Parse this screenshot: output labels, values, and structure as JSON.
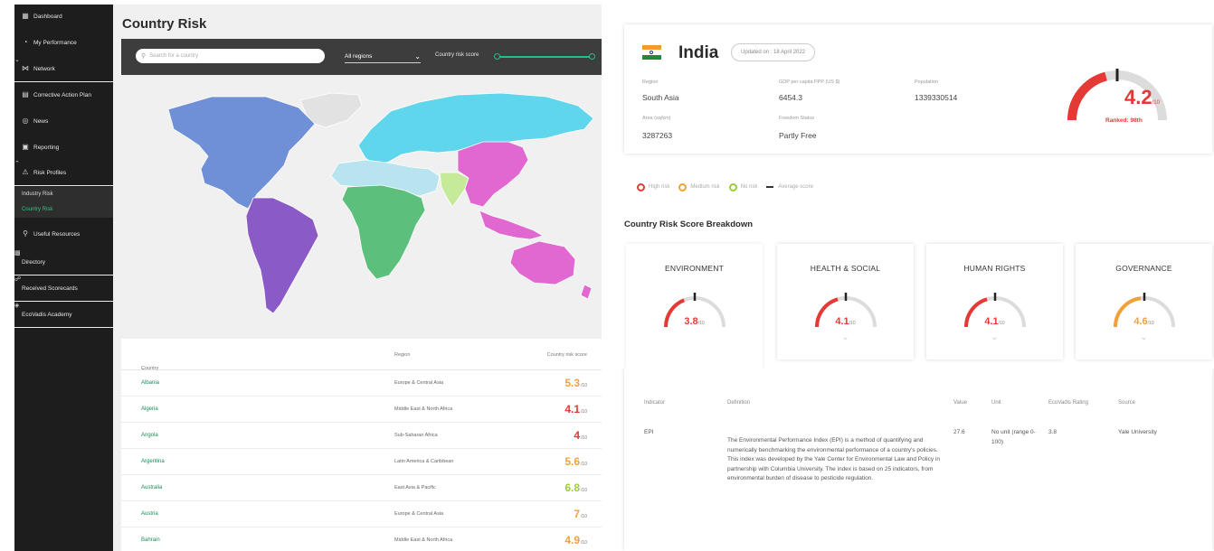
{
  "sidebar": {
    "items": [
      {
        "label": "Dashboard",
        "icon": "dashboard-icon"
      },
      {
        "label": "My Performance",
        "icon": "performance-icon"
      },
      {
        "label": "Network",
        "icon": "network-icon"
      },
      {
        "label": "Corrective Action Plan",
        "icon": "plan-icon"
      },
      {
        "label": "News",
        "icon": "globe-icon"
      },
      {
        "label": "Reporting",
        "icon": "reporting-icon"
      },
      {
        "label": "Risk Profiles",
        "icon": "warning-icon"
      },
      {
        "label": "Useful Resources",
        "icon": "bulb-icon"
      },
      {
        "label": "Directory",
        "icon": "directory-icon"
      },
      {
        "label": "Received Scorecards",
        "icon": "scorecard-icon"
      },
      {
        "label": "EcoVadis Academy",
        "icon": "academy-icon"
      }
    ],
    "sub_items": [
      {
        "label": "Industry Risk",
        "active": false
      },
      {
        "label": "Country Risk",
        "active": true
      }
    ]
  },
  "left": {
    "title": "Country Risk",
    "search_placeholder": "Search for a country",
    "region_selected": "All regions",
    "score_label": "Country risk score"
  },
  "map": {
    "colors": {
      "north_america": "#6f8fd6",
      "south_america": "#8a5bc6",
      "europe_asia": "#5fd6ec",
      "africa": "#5dbf7c",
      "middle_east": "#b7e4ef",
      "india": "#c5ea9a",
      "east_asia": "#e068d0",
      "greenland": "#e2e2e2"
    }
  },
  "table": {
    "headers": {
      "country": "Country",
      "region": "Region",
      "score": "Country risk score"
    },
    "score_suffix": "/10",
    "rows": [
      {
        "country": "Albania",
        "region": "Europe & Central Asia",
        "score": "5.3",
        "color": "#f2a13a"
      },
      {
        "country": "Algeria",
        "region": "Middle East & North Africa",
        "score": "4.1",
        "color": "#e53935"
      },
      {
        "country": "Angola",
        "region": "Sub-Saharan Africa",
        "score": "4",
        "color": "#e53935"
      },
      {
        "country": "Argentina",
        "region": "Latin America & Caribbean",
        "score": "5.6",
        "color": "#f2a13a"
      },
      {
        "country": "Australia",
        "region": "East Asia & Pacific",
        "score": "6.8",
        "color": "#9ccc3c"
      },
      {
        "country": "Austria",
        "region": "Europe & Central Asia",
        "score": "7",
        "color": "#f2a13a"
      },
      {
        "country": "Bahrain",
        "region": "Middle East & North Africa",
        "score": "4.9",
        "color": "#f2a13a"
      }
    ]
  },
  "profile": {
    "country": "India",
    "updated": "Updated on : 18 April 2022",
    "fields": {
      "region_label": "Region",
      "region_value": "South Asia",
      "gdp_label": "GDP per capita PPP (US $)",
      "gdp_value": "6454.3",
      "population_label": "Population",
      "population_value": "1339330514",
      "area_label": "Area (sq/km)",
      "area_value": "3287263",
      "freedom_label": "Freedom Status",
      "freedom_value": "Partly Free"
    },
    "score": "4.2",
    "score_suffix": "/10",
    "score_fraction": 0.42,
    "ranked": "Ranked: 98th",
    "score_color": "#e53935"
  },
  "legend": {
    "items": [
      {
        "label": "High risk",
        "color": "#e53935"
      },
      {
        "label": "Medium risk",
        "color": "#f2a13a"
      },
      {
        "label": "No risk",
        "color": "#9ccc3c"
      }
    ],
    "average_label": "Average score"
  },
  "breakdown": {
    "title": "Country Risk Score Breakdown",
    "score_suffix": "/10",
    "categories": [
      {
        "name": "ENVIRONMENT",
        "score": "3.8",
        "fraction": 0.38,
        "color": "#e53935"
      },
      {
        "name": "HEALTH & SOCIAL",
        "score": "4.1",
        "fraction": 0.41,
        "color": "#e53935"
      },
      {
        "name": "HUMAN RIGHTS",
        "score": "4.1",
        "fraction": 0.41,
        "color": "#e53935"
      },
      {
        "name": "GOVERNANCE",
        "score": "4.6",
        "fraction": 0.46,
        "color": "#f2a13a"
      }
    ]
  },
  "detail": {
    "headers": {
      "indicator": "Indicator",
      "definition": "Definition",
      "value": "Value",
      "unit": "Unit",
      "rating": "EcoVadis Rating",
      "source": "Source"
    },
    "row": {
      "indicator": "EPI",
      "definition": "The Environmental Performance Index (EPI) is a method of quantifying and numerically benchmarking the environmental performance of a country's policies. This index was developed by the Yale Center for Environmental Law and Policy in partnership with Columbia University. The index is based on 25 indicators, from environmental burden of disease to pesticide regulation.",
      "value": "27.6",
      "unit": "No unit (range 0-100)",
      "rating": "3.8",
      "source": "Yale University"
    }
  }
}
